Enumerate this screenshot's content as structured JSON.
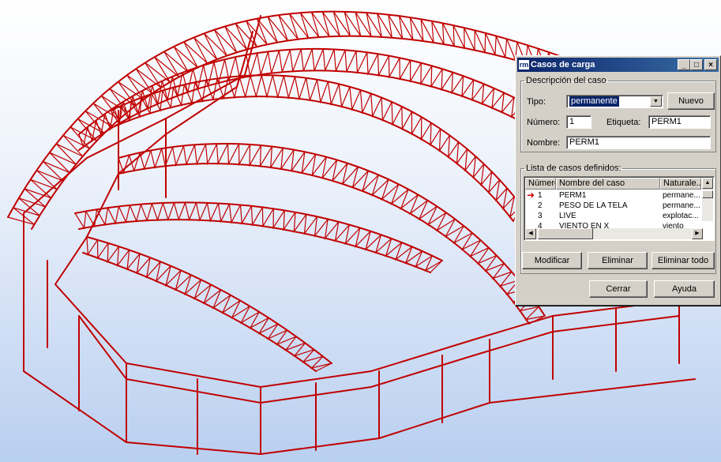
{
  "dialog": {
    "title": "Casos de carga",
    "app_icon": "rm",
    "window_buttons": {
      "minimize": "_",
      "maximize": "□",
      "close": "×"
    },
    "description_group": "Descripción del caso",
    "tipo_label": "Tipo:",
    "tipo_value": "permanente",
    "nuevo_button": "Nuevo",
    "numero_label": "Número:",
    "numero_value": "1",
    "etiqueta_label": "Etiqueta:",
    "etiqueta_value": "PERM1",
    "nombre_label": "Nombre:",
    "nombre_value": "PERM1",
    "list_group": "Lista de casos definidos:",
    "columns": [
      "Número",
      "Nombre del caso",
      "Naturale..."
    ],
    "rows": [
      {
        "num": "1",
        "name": "PERM1",
        "nature": "permane..."
      },
      {
        "num": "2",
        "name": "PESO DE LA TELA",
        "nature": "permane..."
      },
      {
        "num": "3",
        "name": "LIVE",
        "nature": "explotac..."
      },
      {
        "num": "4",
        "name": "VIENTO EN X",
        "nature": "viento"
      }
    ],
    "modificar_button": "Modificar",
    "eliminar_button": "Eliminar",
    "eliminar_todo_button": "Eliminar todo",
    "cerrar_button": "Cerrar",
    "ayuda_button": "Ayuda"
  },
  "colors": {
    "structure": "#c00000",
    "titlebar": "#0a246a",
    "selection_arrow": "#d00000"
  }
}
